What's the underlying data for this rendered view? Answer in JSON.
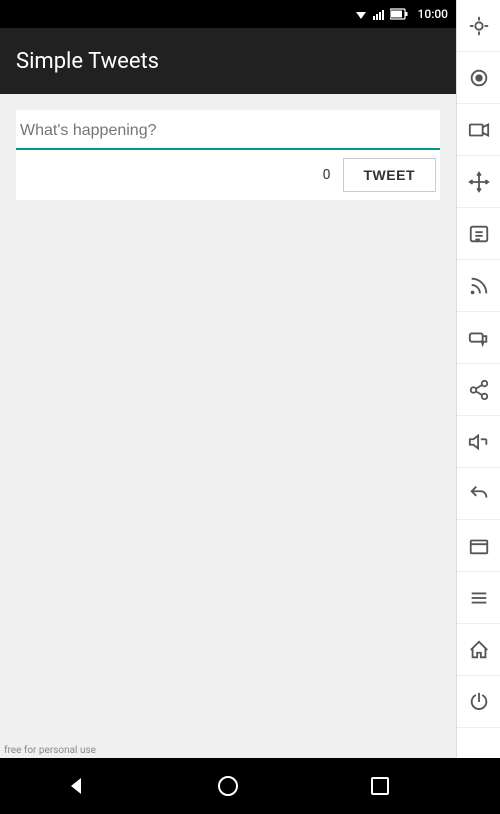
{
  "statusBar": {
    "time": "10:00",
    "icons": [
      "wifi",
      "signal",
      "battery"
    ]
  },
  "header": {
    "title": "Simple Tweets"
  },
  "tweetInput": {
    "placeholder": "What's happening?",
    "value": "",
    "charCount": "0"
  },
  "tweetButton": {
    "label": "TWEET"
  },
  "sidebarIcons": [
    {
      "name": "gps-icon",
      "symbol": "⊕"
    },
    {
      "name": "camera-icon",
      "symbol": "◉"
    },
    {
      "name": "video-icon",
      "symbol": "🎬"
    },
    {
      "name": "move-icon",
      "symbol": "✛"
    },
    {
      "name": "id-icon",
      "symbol": "ID"
    },
    {
      "name": "rss-icon",
      "symbol": "◉"
    },
    {
      "name": "chat-icon",
      "symbol": "▬"
    },
    {
      "name": "share-icon",
      "symbol": "⟨"
    },
    {
      "name": "volume-icon",
      "symbol": "◁+"
    },
    {
      "name": "back-icon",
      "symbol": "↩"
    },
    {
      "name": "window-icon",
      "symbol": "▭"
    },
    {
      "name": "menu-icon",
      "symbol": "☰"
    },
    {
      "name": "home-icon",
      "symbol": "⌂"
    },
    {
      "name": "power-icon",
      "symbol": "⏻"
    }
  ],
  "navBar": {
    "backLabel": "◁",
    "homeLabel": "○",
    "recentLabel": "□"
  },
  "watermark": {
    "text": "free for personal use"
  }
}
